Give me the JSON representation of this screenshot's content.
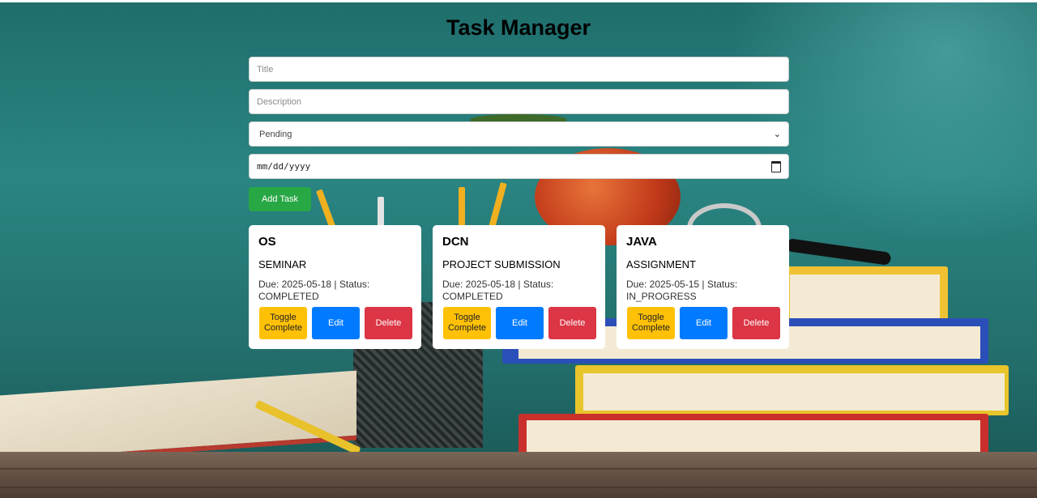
{
  "app": {
    "title": "Task Manager"
  },
  "form": {
    "title_placeholder": "Title",
    "description_placeholder": "Description",
    "status_selected": "Pending",
    "date_placeholder": "mm/dd/yyyy",
    "add_button_label": "Add Task"
  },
  "tasks": [
    {
      "title": "OS",
      "description": "SEMINAR",
      "due_line": "Due: 2025-05-18 | Status:",
      "status": "COMPLETED",
      "toggle_label": "Toggle Complete",
      "edit_label": "Edit",
      "delete_label": "Delete"
    },
    {
      "title": "DCN",
      "description": "PROJECT SUBMISSION",
      "due_line": "Due: 2025-05-18 | Status:",
      "status": "COMPLETED",
      "toggle_label": "Toggle Complete",
      "edit_label": "Edit",
      "delete_label": "Delete"
    },
    {
      "title": "JAVA",
      "description": "ASSIGNMENT",
      "due_line": "Due: 2025-05-15 | Status:",
      "status": "IN_PROGRESS",
      "toggle_label": "Toggle Complete",
      "edit_label": "Edit",
      "delete_label": "Delete"
    }
  ],
  "colors": {
    "add_button": "#28a745",
    "toggle_button": "#ffc107",
    "edit_button": "#007bff",
    "delete_button": "#dc3545",
    "background": "#2a8582"
  }
}
